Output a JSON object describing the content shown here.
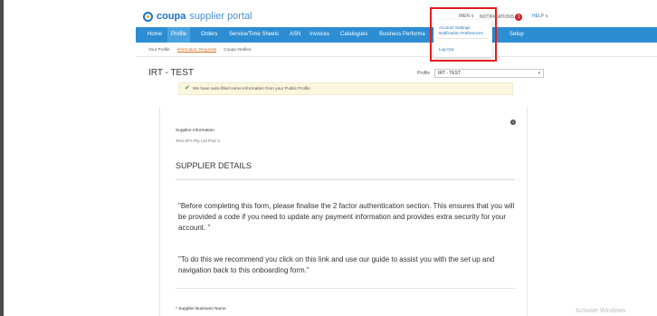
{
  "header": {
    "logo_brand": "coupa",
    "logo_sub": "supplier portal",
    "user_link": "IREN ∨",
    "notifications_label": "NOTIFICATIONS",
    "notifications_count": "1",
    "help_link": "HELP ∨"
  },
  "nav": {
    "items": [
      {
        "label": "Home"
      },
      {
        "label": "Profile"
      },
      {
        "label": "Orders"
      },
      {
        "label": "Service/Time Sheets"
      },
      {
        "label": "ASN"
      },
      {
        "label": "Invoices"
      },
      {
        "label": "Catalogues"
      },
      {
        "label": "Business Performa"
      },
      {
        "label": "Setup"
      }
    ],
    "active": "Profile"
  },
  "subnav": {
    "items": [
      {
        "label": "Your Profile"
      },
      {
        "label": "Information Requests"
      },
      {
        "label": "Coupa Verified"
      }
    ],
    "active": "Information Requests"
  },
  "user_menu": {
    "items": [
      {
        "label": "Account Settings"
      },
      {
        "label": "Notification Preferences"
      },
      {
        "label": "Log Out"
      }
    ]
  },
  "page": {
    "title": "IRT - TEST",
    "profile_label": "Profile",
    "profile_value": "IRT - TEST",
    "notice": "We have auto-filled some information from your Public Profile",
    "supplier_info_label": "Supplier Information",
    "supplier_info_value": "Test 2FA Pty Ltd Part 3",
    "section_heading": "SUPPLIER DETAILS",
    "paragraph1": "\"Before completing this form, please finalise the 2 factor authentication section.  This ensures that you will be provided a code if you need to update any payment information and provides extra security for your account.  \"",
    "paragraph2": "\"To do this we recommend you click on this link and use our guide to assist you with the set up and navigation back to this onboarding form.\"",
    "business_name_label": "* Supplier Business Name"
  },
  "watermark": "Activate Windows",
  "colors": {
    "nav_bg": "#2d8dd2",
    "highlight": "#e51b1b",
    "notice_bg": "#fbf7df",
    "brand": "#1a73c8"
  }
}
